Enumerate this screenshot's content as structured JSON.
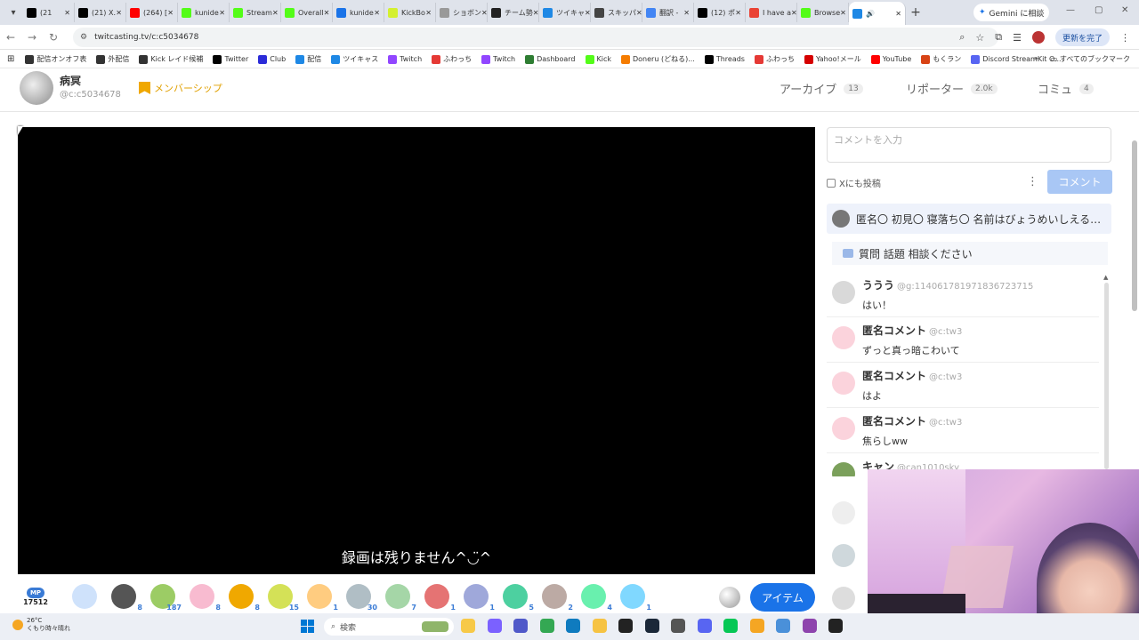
{
  "browser": {
    "tabs": [
      {
        "label": "(21",
        "color": "#000000"
      },
      {
        "label": "(21) X.",
        "color": "#000000"
      },
      {
        "label": "(264) [",
        "color": "#ff0000"
      },
      {
        "label": "kunide",
        "color": "#53fc18"
      },
      {
        "label": "Stream",
        "color": "#53fc18"
      },
      {
        "label": "Overall",
        "color": "#53fc18"
      },
      {
        "label": "kunide",
        "color": "#1a73e8"
      },
      {
        "label": "KickBo",
        "color": "#d4f030"
      },
      {
        "label": "ショボン",
        "color": "#999999"
      },
      {
        "label": "チーム勢",
        "color": "#222222"
      },
      {
        "label": "ツイキャ",
        "color": "#1e88e5"
      },
      {
        "label": "スキッパ",
        "color": "#444444"
      },
      {
        "label": "翻訳 - ",
        "color": "#4285f4"
      },
      {
        "label": "(12) ポ",
        "color": "#000000"
      },
      {
        "label": "I have a",
        "color": "#ea4335"
      },
      {
        "label": "Browse",
        "color": "#53fc18"
      }
    ],
    "active_tab_label": "",
    "new_tab": "+",
    "gemini_button": "Gemini に相談",
    "url": "twitcasting.tv/c:c5034678",
    "update_button": "更新を完了",
    "bookmarks": [
      {
        "label": "配信オンオフ表",
        "color": "#333333"
      },
      {
        "label": "外配信",
        "color": "#333333"
      },
      {
        "label": "Kick レイド候補",
        "color": "#333333"
      },
      {
        "label": "Twitter",
        "color": "#000000"
      },
      {
        "label": "Club",
        "color": "#2b2bd8"
      },
      {
        "label": "配信",
        "color": "#1e88e5"
      },
      {
        "label": "ツイキャス",
        "color": "#1e88e5"
      },
      {
        "label": "Twitch",
        "color": "#9146ff"
      },
      {
        "label": "ふわっち",
        "color": "#e53935"
      },
      {
        "label": "Twitch",
        "color": "#9146ff"
      },
      {
        "label": "Dashboard",
        "color": "#2e7d32"
      },
      {
        "label": "Kick",
        "color": "#53fc18"
      },
      {
        "label": "Doneru (どねる)...",
        "color": "#f57c00"
      },
      {
        "label": "Threads",
        "color": "#000000"
      },
      {
        "label": "ふわっち",
        "color": "#e53935"
      },
      {
        "label": "Yahoo!メール",
        "color": "#d50000"
      },
      {
        "label": "YouTube",
        "color": "#ff0000"
      },
      {
        "label": "もくラン",
        "color": "#d84315"
      },
      {
        "label": "Discord StreamKit O...",
        "color": "#5865f2"
      }
    ],
    "bookmarks_more": "»",
    "all_bookmarks": "すべてのブックマーク"
  },
  "profile": {
    "name": "病冥",
    "id": "@c:c5034678",
    "membership": "メンバーシップ"
  },
  "header_nav": [
    {
      "label": "アーカイブ",
      "count": "13"
    },
    {
      "label": "リポーター",
      "count": "2.0k"
    },
    {
      "label": "コミュ",
      "count": "4"
    }
  ],
  "video": {
    "caption": "録画は残りません^◡̈^"
  },
  "gift_bar": {
    "mp_label": "MP",
    "mp_value": "17512",
    "gifts": [
      {
        "icon": "smile-gift-icon",
        "count": "",
        "color": "#cfe2fb"
      },
      {
        "icon": "penguin-gift-icon",
        "count": "8",
        "color": "#555555"
      },
      {
        "icon": "tea-gift-icon",
        "count": "187",
        "color": "#9ccc65"
      },
      {
        "icon": "hands-gift-icon",
        "count": "8",
        "color": "#f8bbd0"
      },
      {
        "icon": "crown-gift-icon",
        "count": "8",
        "color": "#f0a800"
      },
      {
        "icon": "scroll-gift-icon",
        "count": "15",
        "color": "#d4e157"
      },
      {
        "icon": "heart-gift-icon",
        "count": "1",
        "color": "#ffcc80"
      },
      {
        "icon": "robot-gift-icon",
        "count": "30",
        "color": "#b0bec5"
      },
      {
        "icon": "drink-gift-icon",
        "count": "7",
        "color": "#a5d6a7"
      },
      {
        "icon": "cake-gift-icon",
        "count": "1",
        "color": "#e57373"
      },
      {
        "icon": "ghost-gift-icon",
        "count": "1",
        "color": "#9fa8da"
      },
      {
        "icon": "star-gift-icon",
        "count": "5",
        "color": "#4dd0a0"
      },
      {
        "icon": "people-gift-icon",
        "count": "2",
        "color": "#bcaaa4"
      },
      {
        "icon": "star-gift-icon",
        "count": "4",
        "color": "#69f0ae"
      },
      {
        "icon": "butterfly-gift-icon",
        "count": "1",
        "color": "#80d8ff"
      }
    ],
    "item_button": "アイテム"
  },
  "comments_panel": {
    "input_placeholder": "コメントを入力",
    "x_post_label": "Xにも投稿",
    "kebab": "⋮",
    "comment_button": "コメント",
    "pinned_text": "匿名〇 初見〇 寝落ち〇 名前はびょうめいしえる…",
    "topics_text": "質問 話題 相談ください",
    "comments": [
      {
        "name": "ううう",
        "id": "@g:114061781971836723715",
        "text": "はい！",
        "avatar_color": "#d9d9d9"
      },
      {
        "name": "匿名コメント",
        "id": "@c:tw3",
        "text": "ずっと真っ暗こわいて",
        "avatar_color": "#fbd3dc"
      },
      {
        "name": "匿名コメント",
        "id": "@c:tw3",
        "text": "はよ",
        "avatar_color": "#fbd3dc"
      },
      {
        "name": "匿名コメント",
        "id": "@c:tw3",
        "text": "焦らしww",
        "avatar_color": "#fbd3dc"
      },
      {
        "name": "キャン",
        "id": "@can1010sky",
        "text": "",
        "avatar_color": "#7ba05b"
      }
    ]
  },
  "taskbar": {
    "temperature": "26°C",
    "weather_text": "くもり時々晴れ",
    "search_label": "検索",
    "icons": [
      {
        "name": "file-explorer-icon",
        "color": "#f7c948"
      },
      {
        "name": "copilot-icon",
        "color": "#7b61ff"
      },
      {
        "name": "teams-icon",
        "color": "#5059c9"
      },
      {
        "name": "chrome-icon",
        "color": "#34a853"
      },
      {
        "name": "edge-icon",
        "color": "#0f7bbf"
      },
      {
        "name": "folder-icon",
        "color": "#f6c343"
      },
      {
        "name": "obs-icon",
        "color": "#222222"
      },
      {
        "name": "steam-icon",
        "color": "#1b2838"
      },
      {
        "name": "app-icon",
        "color": "#555555"
      },
      {
        "name": "discord-icon",
        "color": "#5865f2"
      },
      {
        "name": "line-icon",
        "color": "#06c755"
      },
      {
        "name": "app2-icon",
        "color": "#f5a623"
      },
      {
        "name": "notepad-icon",
        "color": "#4a90d9"
      },
      {
        "name": "app3-icon",
        "color": "#8e44ad"
      },
      {
        "name": "terminal-icon",
        "color": "#222222"
      }
    ]
  }
}
